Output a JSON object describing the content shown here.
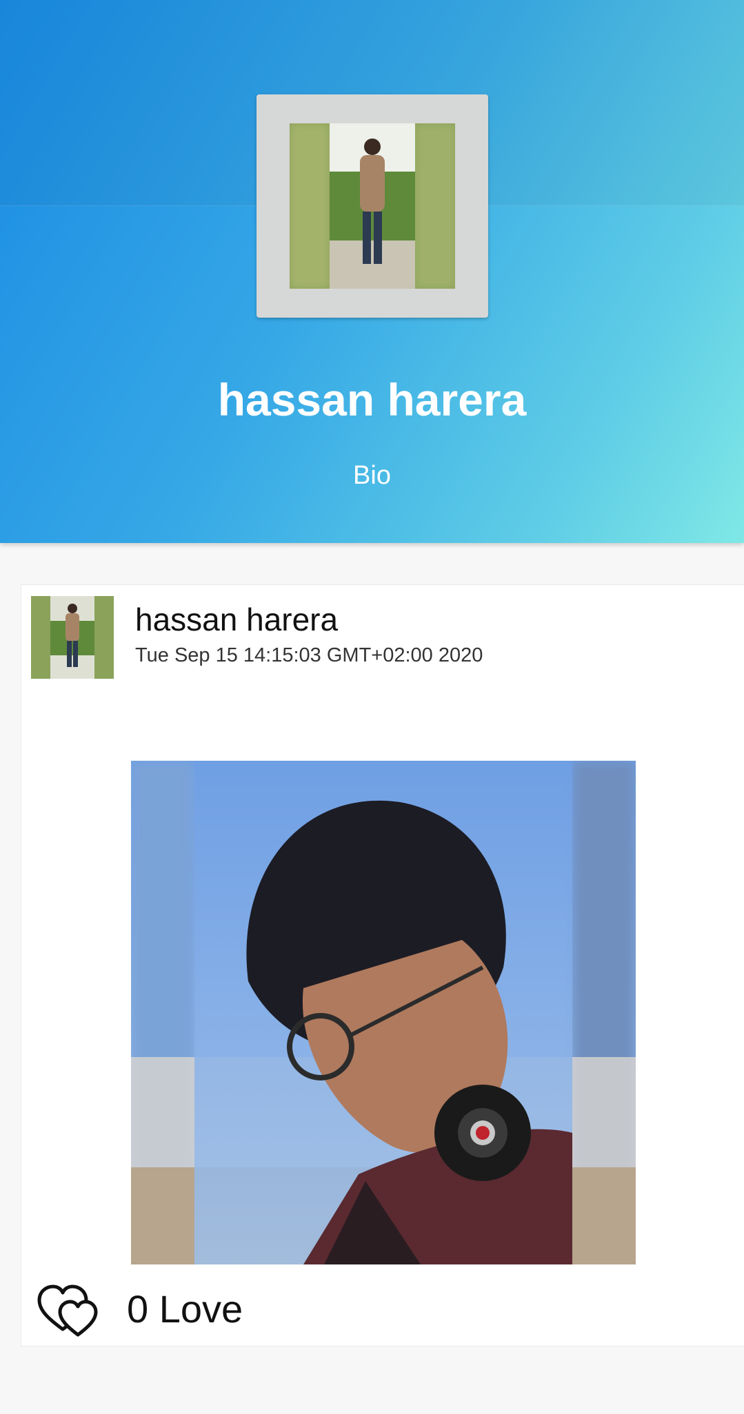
{
  "profile": {
    "name": "hassan harera",
    "bio": "Bio"
  },
  "post": {
    "author": "hassan harera",
    "timestamp": "Tue Sep 15 14:15:03 GMT+02:00 2020",
    "love_count_label": "0 Love",
    "love_icon": "hearts-icon"
  },
  "colors": {
    "header_gradient_start": "#1a8be3",
    "header_gradient_end": "#7fe8e6",
    "avatar_frame": "#d6d7d7",
    "text_dark": "#111111"
  }
}
